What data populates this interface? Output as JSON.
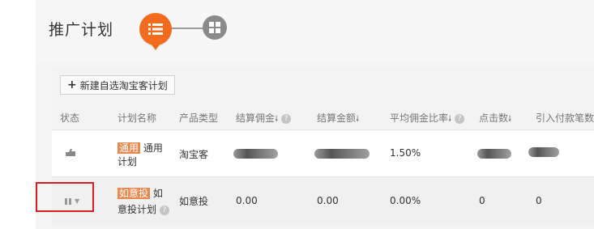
{
  "page_title": "推广计划",
  "toolbar": {
    "new_plan_label": "新建自选淘宝客计划"
  },
  "table": {
    "headers": {
      "status": "状态",
      "plan_name": "计划名称",
      "product_type": "产品类型",
      "settle_commission": "结算佣金",
      "settle_amount": "结算金额",
      "avg_commission_rate": "平均佣金比率",
      "clicks": "点击数",
      "paid_orders": "引入付款笔数"
    },
    "rows": [
      {
        "tag": "通用",
        "name_rest": "通用",
        "name_line2": "计划",
        "product_type": "淘宝客",
        "avg_commission_rate": "1.50%"
      },
      {
        "tag": "如意投",
        "name_rest": "如",
        "name_line2": "意投计划",
        "product_type": "如意投",
        "settle_commission": "0.00",
        "settle_amount": "0.00",
        "avg_commission_rate": "0.00%",
        "clicks": "0",
        "paid_orders": "0"
      }
    ]
  },
  "icons": {
    "step1": "list-icon",
    "step2": "grid-icon",
    "row1_status": "thumb-icon",
    "row2_status": "pause-icon"
  },
  "colors": {
    "accent": "#f36b1c",
    "tag": "#e8894f",
    "highlight_box": "#d61f1f"
  }
}
